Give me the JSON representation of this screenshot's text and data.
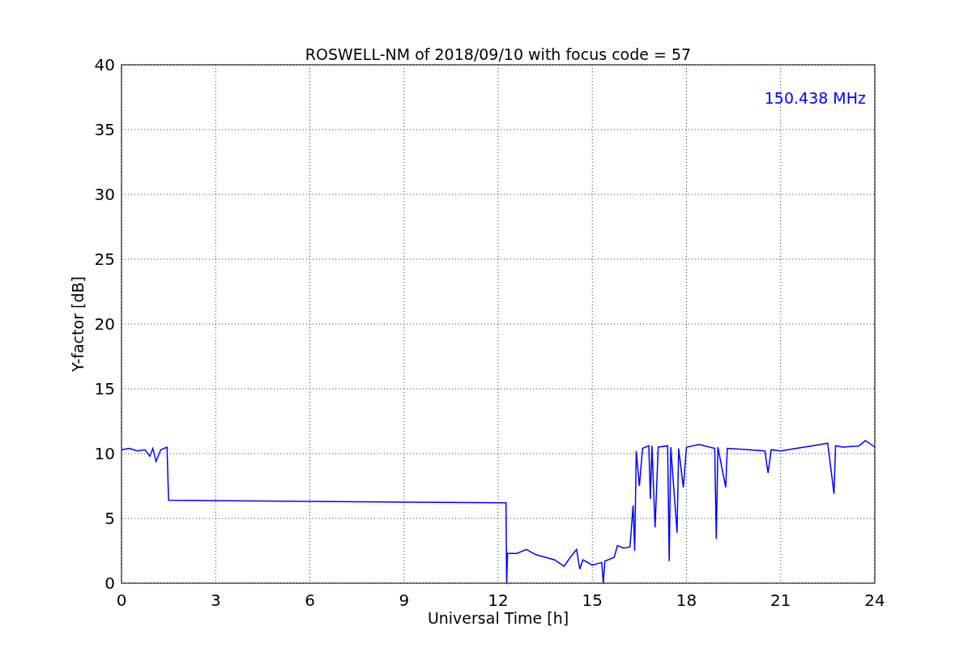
{
  "figure": {
    "chart_data": {
      "type": "line",
      "title": "ROSWELL-NM of 2018/09/10 with focus code = 57",
      "xlabel": "Universal Time [h]",
      "ylabel": "Y-factor [dB]",
      "x": [
        0,
        0.25,
        0.5,
        0.75,
        0.9,
        1.0,
        1.1,
        1.25,
        1.45,
        1.5,
        12.25,
        12.27,
        12.3,
        12.6,
        12.9,
        13.2,
        13.5,
        13.8,
        14.1,
        14.3,
        14.5,
        14.6,
        14.7,
        15.0,
        15.3,
        15.35,
        15.4,
        15.7,
        15.8,
        16.0,
        16.2,
        16.3,
        16.35,
        16.4,
        16.5,
        16.6,
        16.8,
        16.85,
        16.9,
        17.0,
        17.1,
        17.4,
        17.45,
        17.5,
        17.7,
        17.75,
        17.9,
        18.0,
        18.4,
        18.9,
        18.95,
        19.0,
        19.25,
        19.3,
        20.0,
        20.5,
        20.6,
        20.7,
        21.0,
        21.5,
        22.0,
        22.5,
        22.7,
        22.75,
        23.0,
        23.5,
        23.7,
        24.0
      ],
      "series": [
        {
          "color": "#0000ff",
          "values": [
            10.3,
            10.4,
            10.2,
            10.3,
            9.8,
            10.4,
            9.4,
            10.3,
            10.5,
            6.4,
            6.2,
            0,
            2.3,
            2.3,
            2.6,
            2.2,
            2.0,
            1.8,
            1.3,
            2.0,
            2.6,
            1.1,
            1.8,
            1.4,
            1.6,
            0,
            1.7,
            2.0,
            2.9,
            2.7,
            2.8,
            6.0,
            2.5,
            10.2,
            7.5,
            10.4,
            10.6,
            6.5,
            10.6,
            4.3,
            10.5,
            10.6,
            1.7,
            10.5,
            3.9,
            10.4,
            7.4,
            10.5,
            10.7,
            10.4,
            3.4,
            10.5,
            7.4,
            10.4,
            10.3,
            10.2,
            8.5,
            10.3,
            10.2,
            10.4,
            10.6,
            10.8,
            6.9,
            10.6,
            10.5,
            10.6,
            11.0,
            10.5
          ]
        }
      ],
      "xlim": [
        0,
        24
      ],
      "ylim": [
        0,
        40
      ],
      "xticks": [
        0,
        3,
        6,
        9,
        12,
        15,
        18,
        21,
        24
      ],
      "yticks": [
        0,
        5,
        10,
        15,
        20,
        25,
        30,
        35,
        40
      ],
      "grid": true,
      "annotations": [
        {
          "text": "150.438 MHz"
        }
      ]
    }
  }
}
